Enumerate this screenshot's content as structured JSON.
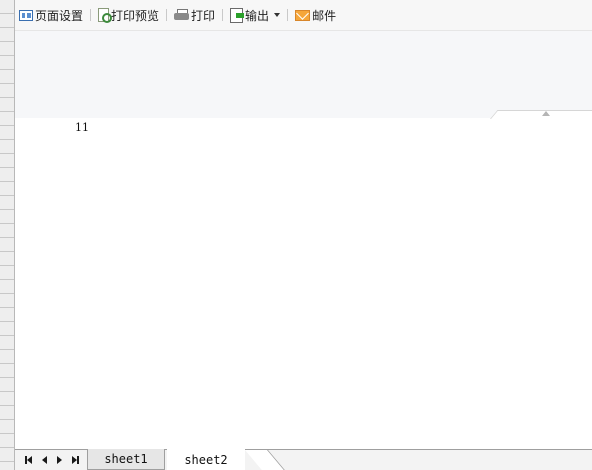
{
  "toolbar": {
    "page_setup": {
      "label": "页面设置",
      "icon": "page-setup-icon"
    },
    "print_preview": {
      "label": "打印预览",
      "icon": "print-preview-icon"
    },
    "print": {
      "label": "打印",
      "icon": "printer-icon"
    },
    "export": {
      "label": "输出",
      "icon": "export-icon"
    },
    "mail": {
      "label": "邮件",
      "icon": "mail-icon"
    }
  },
  "sheet": {
    "cells": [
      {
        "text": "11"
      }
    ]
  },
  "sheet_tabs": [
    {
      "label": "sheet1",
      "active": false
    },
    {
      "label": "sheet2",
      "active": true
    }
  ],
  "colors": {
    "toolbar_bg": "#f7f7f7",
    "band_bg": "#f6f7f9",
    "active_tab_bg": "#ffffff",
    "inactive_tab_bg": "#e6e6e6"
  }
}
